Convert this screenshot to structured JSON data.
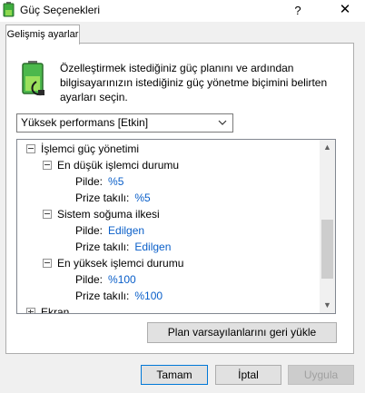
{
  "window": {
    "title": "Güç Seçenekleri",
    "help_glyph": "?",
    "close_glyph": "✕"
  },
  "tab": {
    "label": "Gelişmiş ayarlar"
  },
  "description": "Özelleştirmek istediğiniz güç planını ve ardından bilgisayarınızın istediğiniz güç yönetme biçimini belirten ayarları seçin.",
  "plan_select": {
    "value": "Yüksek performans [Etkin]"
  },
  "tree": {
    "group_label": "İşlemci güç yönetimi",
    "min_state": {
      "label": "En düşük işlemci durumu",
      "battery_label": "Pilde:",
      "battery_value": "%5",
      "plugged_label": "Prize takılı:",
      "plugged_value": "%5"
    },
    "cooling": {
      "label": "Sistem soğuma ilkesi",
      "battery_label": "Pilde:",
      "battery_value": "Edilgen",
      "plugged_label": "Prize takılı:",
      "plugged_value": "Edilgen"
    },
    "max_state": {
      "label": "En yüksek işlemci durumu",
      "battery_label": "Pilde:",
      "battery_value": "%100",
      "plugged_label": "Prize takılı:",
      "plugged_value": "%100"
    },
    "next_group_label": "Ekran"
  },
  "buttons": {
    "restore": "Plan varsayılanlarını geri yükle",
    "ok": "Tamam",
    "cancel": "İptal",
    "apply": "Uygula"
  },
  "colors": {
    "value_link": "#0a5fc9",
    "ok_border": "#0078d7"
  }
}
